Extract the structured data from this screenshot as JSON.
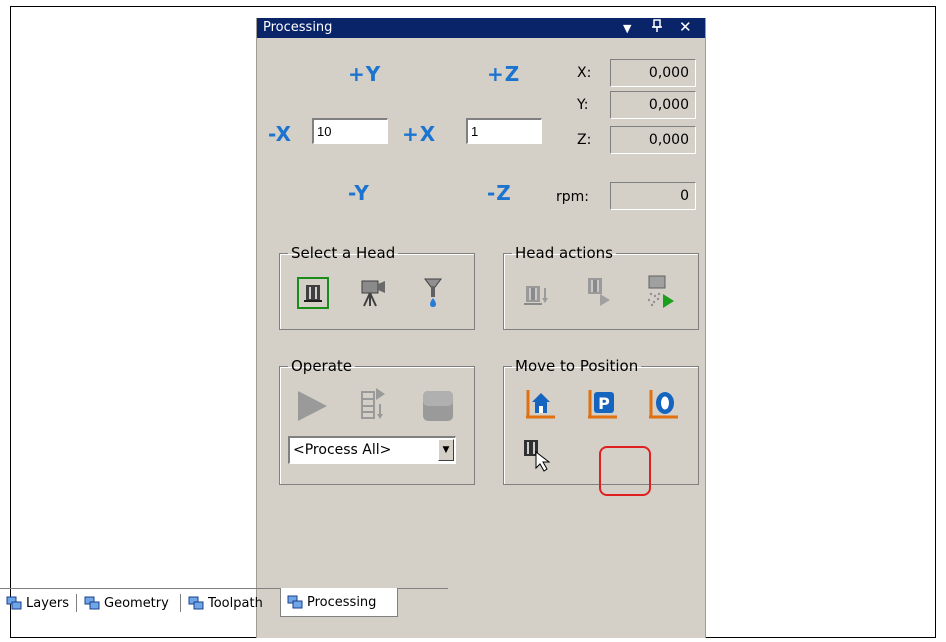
{
  "window": {
    "title": "Processing"
  },
  "jog": {
    "plus_y": "+Y",
    "plus_z": "+Z",
    "minus_x": "-X",
    "plus_x": "+X",
    "minus_y": "-Y",
    "minus_z": "-Z",
    "step_xy_value": "10",
    "step_z_value": "1"
  },
  "readouts": [
    {
      "label": "X:",
      "value": "0,000"
    },
    {
      "label": "Y:",
      "value": "0,000"
    },
    {
      "label": "Z:",
      "value": "0,000"
    },
    {
      "label": "rpm:",
      "value": "0"
    }
  ],
  "groups": {
    "select_head": "Select a Head",
    "head_actions": "Head actions",
    "operate": "Operate",
    "move_to_position": "Move to Position"
  },
  "operate": {
    "process_selected": "<Process All>"
  },
  "tabs": [
    {
      "label": "Layers"
    },
    {
      "label": "Geometry"
    },
    {
      "label": "Toolpath"
    },
    {
      "label": "Processing"
    }
  ],
  "colors": {
    "title_bar": "#0a246a",
    "panel": "#d4d0c8",
    "jog_blue": "#1b74cf",
    "highlight": "#e02020"
  }
}
